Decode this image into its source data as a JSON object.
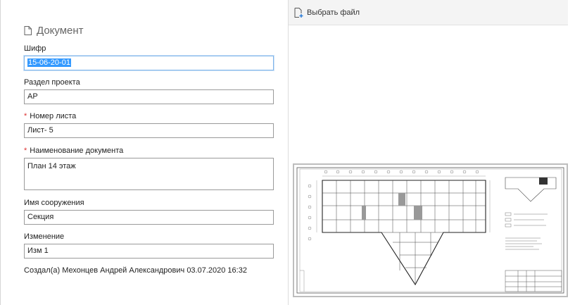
{
  "document": {
    "title": "Документ",
    "fields": {
      "shifr": {
        "label": "Шифр",
        "value": "15-06-20-01"
      },
      "section": {
        "label": "Раздел проекта",
        "value": "АР"
      },
      "sheet_number": {
        "label": "Номер листа",
        "value": "Лист- 5",
        "required": true
      },
      "doc_name": {
        "label": "Наименование документа",
        "value": "План 14 этаж",
        "required": true
      },
      "structure_name": {
        "label": "Имя сооружения",
        "value": "Секция"
      },
      "change": {
        "label": "Изменение",
        "value": "Изм 1"
      }
    },
    "created_by": "Создал(а) Мехонцев Андрей Александрович 03.07.2020 16:32"
  },
  "toolbar": {
    "choose_file_label": "Выбрать файл"
  },
  "colors": {
    "required_marker": "#d33333",
    "selection": "#3399ff",
    "focus_border": "#7eb4ea"
  },
  "icons": {
    "document": "document-icon",
    "add_file": "add-file-icon"
  }
}
